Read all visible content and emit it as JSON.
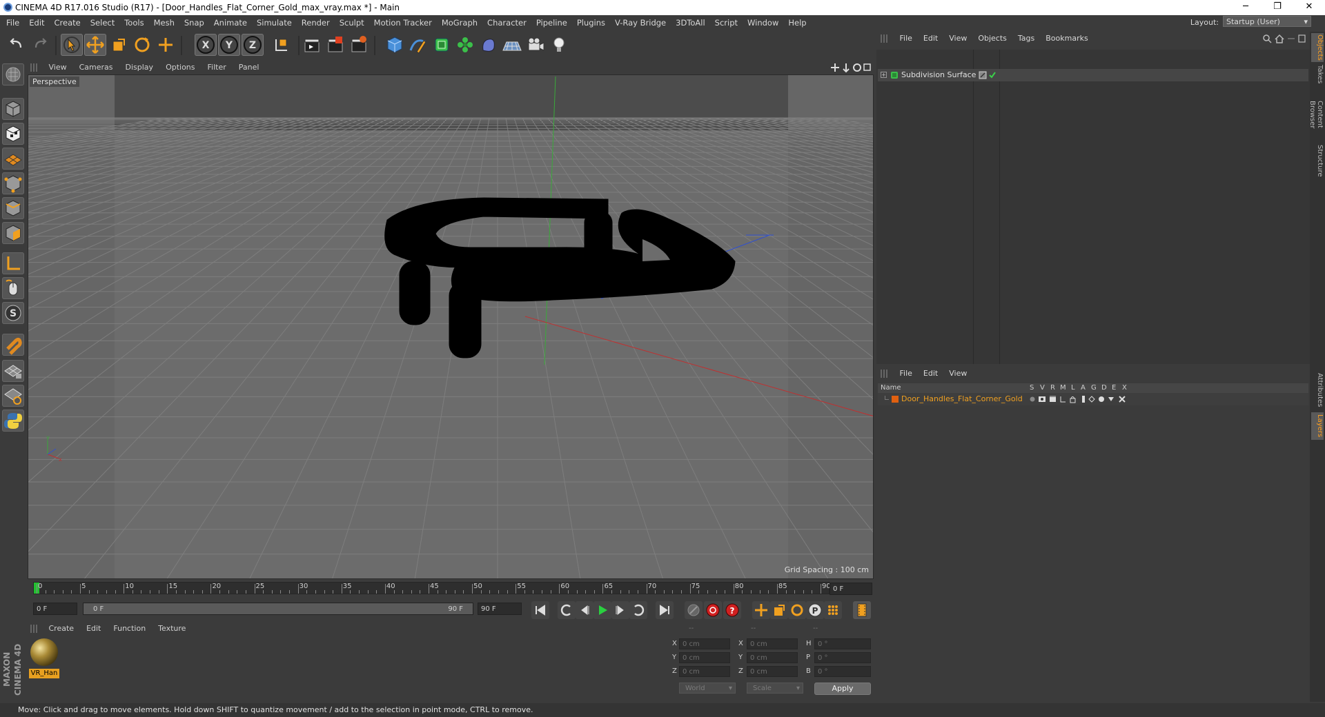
{
  "window": {
    "title": "CINEMA 4D R17.016 Studio (R17) - [Door_Handles_Flat_Corner_Gold_max_vray.max *] - Main",
    "minimize": "─",
    "restore": "❐",
    "close": "✕"
  },
  "menubar": {
    "items": [
      "File",
      "Edit",
      "Create",
      "Select",
      "Tools",
      "Mesh",
      "Snap",
      "Animate",
      "Simulate",
      "Render",
      "Sculpt",
      "Motion Tracker",
      "MoGraph",
      "Character",
      "Pipeline",
      "Plugins",
      "V-Ray Bridge",
      "3DToAll",
      "Script",
      "Window",
      "Help"
    ],
    "layout_label": "Layout:",
    "layout_value": "Startup (User)"
  },
  "viewport": {
    "menu": [
      "View",
      "Cameras",
      "Display",
      "Options",
      "Filter",
      "Panel"
    ],
    "camera_label": "Perspective",
    "grid_spacing": "Grid Spacing : 100 cm"
  },
  "timeline": {
    "ticks": [
      "0",
      "5",
      "10",
      "15",
      "20",
      "25",
      "30",
      "35",
      "40",
      "45",
      "50",
      "55",
      "60",
      "65",
      "70",
      "75",
      "80",
      "85",
      "90"
    ],
    "end_field": "0 F"
  },
  "transport": {
    "start_field": "0 F",
    "range_start": "0 F",
    "range_end": "90 F",
    "end_field": "90 F"
  },
  "material_manager": {
    "menu": [
      "Create",
      "Edit",
      "Function",
      "Texture"
    ],
    "material_name": "VR_Han"
  },
  "coordinates": {
    "headers": [
      "--",
      "--",
      "--"
    ],
    "rows": [
      {
        "l1": "X",
        "v1": "0 cm",
        "l2": "X",
        "v2": "0 cm",
        "l3": "H",
        "v3": "0 °"
      },
      {
        "l1": "Y",
        "v1": "0 cm",
        "l2": "Y",
        "v2": "0 cm",
        "l3": "P",
        "v3": "0 °"
      },
      {
        "l1": "Z",
        "v1": "0 cm",
        "l2": "Z",
        "v2": "0 cm",
        "l3": "B",
        "v3": "0 °"
      }
    ],
    "space": "World",
    "mode": "Scale",
    "apply": "Apply"
  },
  "status": "Move: Click and drag to move elements. Hold down SHIFT to quantize movement / add to the selection in point mode, CTRL to remove.",
  "object_manager": {
    "menu": [
      "File",
      "Edit",
      "View",
      "Objects",
      "Tags",
      "Bookmarks"
    ],
    "objects": [
      {
        "name": "Subdivision Surface"
      }
    ]
  },
  "layer_manager": {
    "menu": [
      "File",
      "Edit",
      "View"
    ],
    "columns": [
      "Name",
      "S",
      "V",
      "R",
      "M",
      "L",
      "A",
      "G",
      "D",
      "E",
      "X"
    ],
    "layers": [
      {
        "name": "Door_Handles_Flat_Corner_Gold",
        "color": "#e06010"
      }
    ]
  },
  "right_tabs": [
    "Objects",
    "Takes",
    "Content Browser",
    "Structure",
    "Attributes",
    "Layers"
  ],
  "branding": "MAXON CINEMA 4D",
  "colors": {
    "accent": "#ffa020",
    "layer_text": "#f0a020"
  }
}
